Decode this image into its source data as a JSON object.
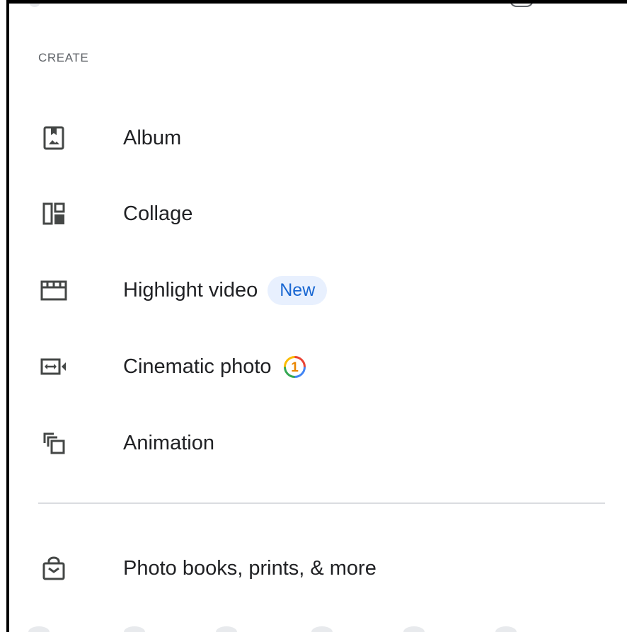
{
  "menu": {
    "section_label": "CREATE",
    "items": [
      {
        "label": "Album",
        "icon": "album-icon"
      },
      {
        "label": "Collage",
        "icon": "collage-icon"
      },
      {
        "label": "Highlight video",
        "icon": "movie-icon",
        "badge": "New"
      },
      {
        "label": "Cinematic photo",
        "icon": "cinematic-icon",
        "count": "1"
      },
      {
        "label": "Animation",
        "icon": "animation-icon"
      }
    ],
    "bottom_item": {
      "label": "Photo books, prints, & more",
      "icon": "shopping-bag-icon"
    }
  },
  "colors": {
    "text": "#202124",
    "secondary_text": "#5f6368",
    "icon": "#444746",
    "badge_bg": "#e8f0fe",
    "badge_text": "#1967d2",
    "divider": "#dadce0"
  }
}
